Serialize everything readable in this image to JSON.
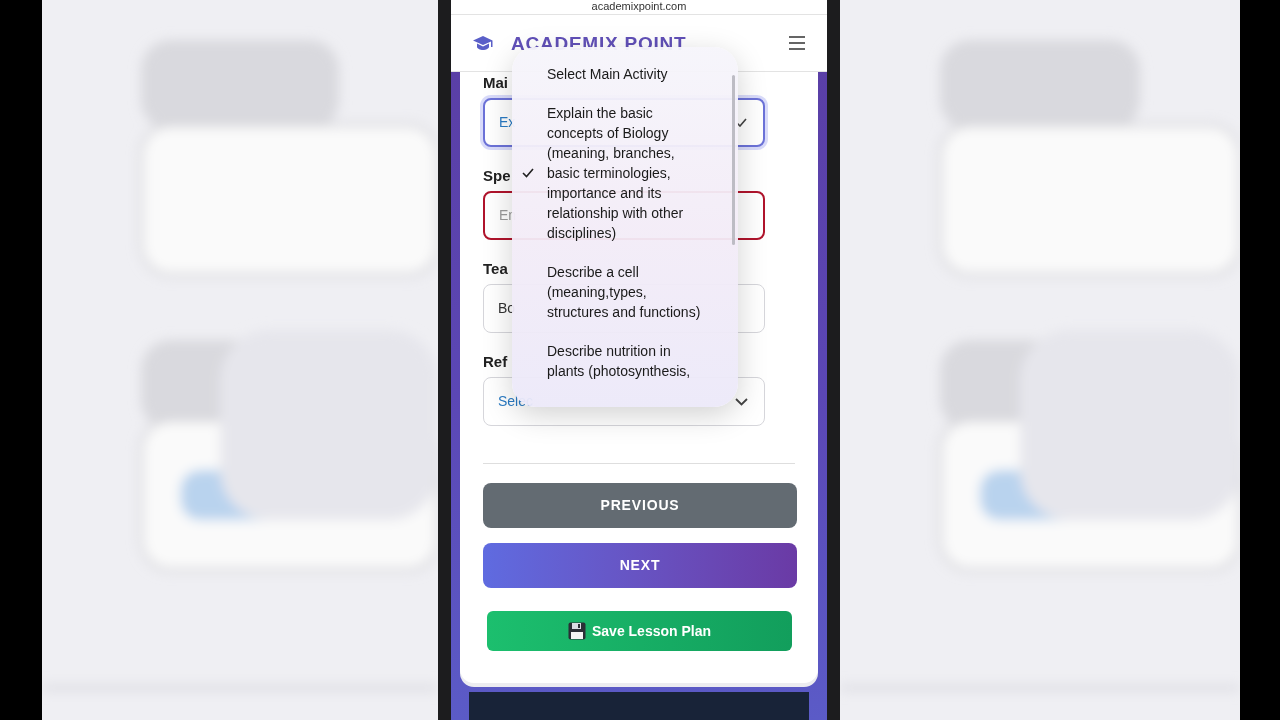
{
  "browser": {
    "url": "academixpoint.com"
  },
  "header": {
    "brand": "ACADEMIX POINT"
  },
  "form": {
    "fields": [
      {
        "kind": "select",
        "label": "Mai",
        "value": "Ex",
        "focused": true,
        "invalid": false
      },
      {
        "kind": "input",
        "label": "Spe",
        "placeholder": "En",
        "focused": false,
        "invalid": true
      },
      {
        "kind": "input",
        "label": "Tea",
        "value": "Bo",
        "focused": false,
        "invalid": false
      },
      {
        "kind": "select",
        "label": "Ref",
        "value": "Selec",
        "focused": false,
        "invalid": false
      }
    ]
  },
  "dropdown": {
    "options": [
      {
        "text": "Select Main Activity",
        "selected": false
      },
      {
        "text": "Explain the basic concepts of Biology (meaning, branches, basic terminologies, importance and its relationship with other disciplines)",
        "selected": true
      },
      {
        "text": "Describe a cell (meaning,types, structures and functions)",
        "selected": false
      },
      {
        "text": "Describe nutrition in plants (photosynthesis,",
        "selected": false
      }
    ]
  },
  "buttons": [
    {
      "kind": "secondary",
      "label": "PREVIOUS"
    },
    {
      "kind": "primary",
      "label": "NEXT"
    },
    {
      "kind": "success",
      "label": "Save Lesson Plan"
    }
  ]
}
